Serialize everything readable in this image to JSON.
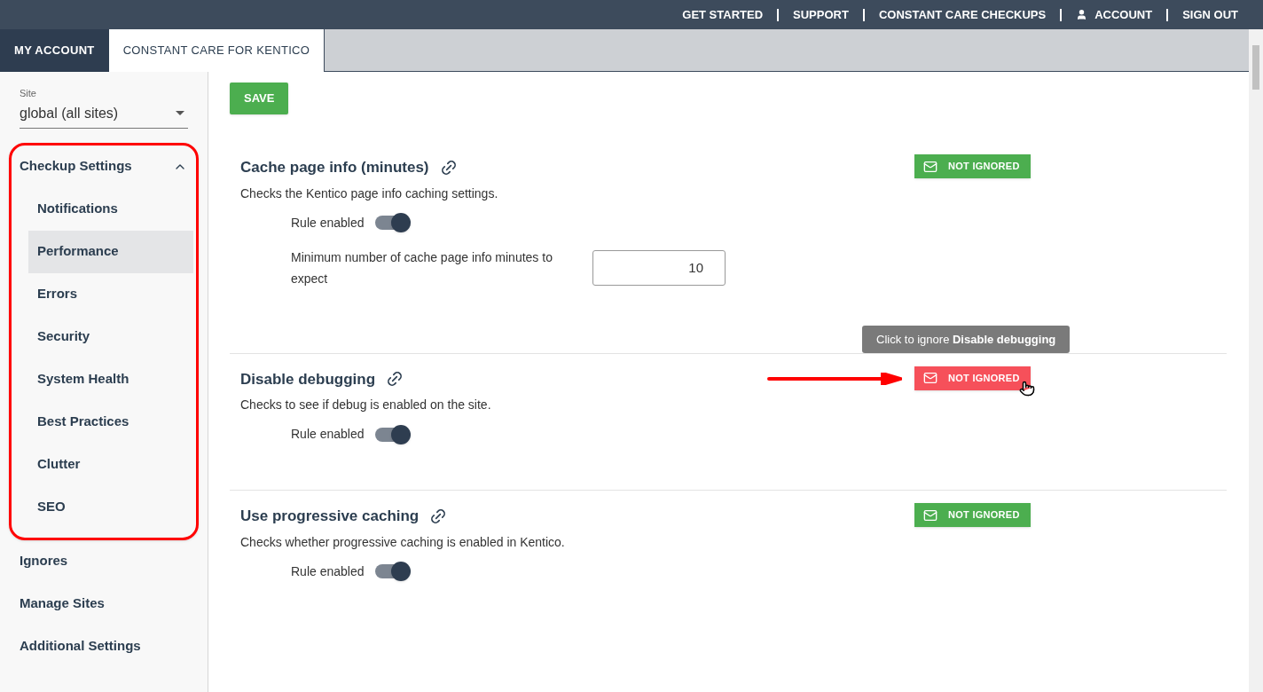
{
  "top_nav": [
    {
      "label": "GET STARTED",
      "icon": false
    },
    {
      "label": "SUPPORT",
      "icon": false
    },
    {
      "label": "CONSTANT CARE CHECKUPS",
      "icon": false
    },
    {
      "label": "ACCOUNT",
      "icon": true
    },
    {
      "label": "SIGN OUT",
      "icon": false
    }
  ],
  "tabs": [
    {
      "label": "MY ACCOUNT",
      "selected": false
    },
    {
      "label": "CONSTANT CARE FOR KENTICO",
      "selected": true
    }
  ],
  "sidebar": {
    "site_label": "Site",
    "site_value": "global (all sites)",
    "items": [
      {
        "label": "Checkup Settings",
        "expanded": true,
        "highlighted": true,
        "children": [
          {
            "label": "Notifications",
            "selected": false
          },
          {
            "label": "Performance",
            "selected": true
          },
          {
            "label": "Errors",
            "selected": false
          },
          {
            "label": "Security",
            "selected": false
          },
          {
            "label": "System Health",
            "selected": false
          },
          {
            "label": "Best Practices",
            "selected": false
          },
          {
            "label": "Clutter",
            "selected": false
          },
          {
            "label": "SEO",
            "selected": false
          }
        ]
      },
      {
        "label": "Ignores"
      },
      {
        "label": "Manage Sites"
      },
      {
        "label": "Additional Settings"
      }
    ]
  },
  "save_button": "SAVE",
  "rules": [
    {
      "title": "Cache page info (minutes)",
      "description": "Checks the Kentico page info caching settings.",
      "enabled_label": "Rule enabled",
      "enabled": true,
      "status": "NOT IGNORED",
      "hovered": false,
      "setting": {
        "label": "Minimum number of cache page info minutes to expect",
        "value": "10"
      }
    },
    {
      "title": "Disable debugging",
      "description": "Checks to see if debug is enabled on the site.",
      "enabled_label": "Rule enabled",
      "enabled": true,
      "status": "NOT IGNORED",
      "hovered": true,
      "pointer_arrow": true,
      "tooltip": "Click to ignore **Disable debugging**"
    },
    {
      "title": "Use progressive caching",
      "description": "Checks whether progressive caching is enabled in Kentico.",
      "enabled_label": "Rule enabled",
      "enabled": true,
      "status": "NOT IGNORED",
      "hovered": false
    }
  ]
}
